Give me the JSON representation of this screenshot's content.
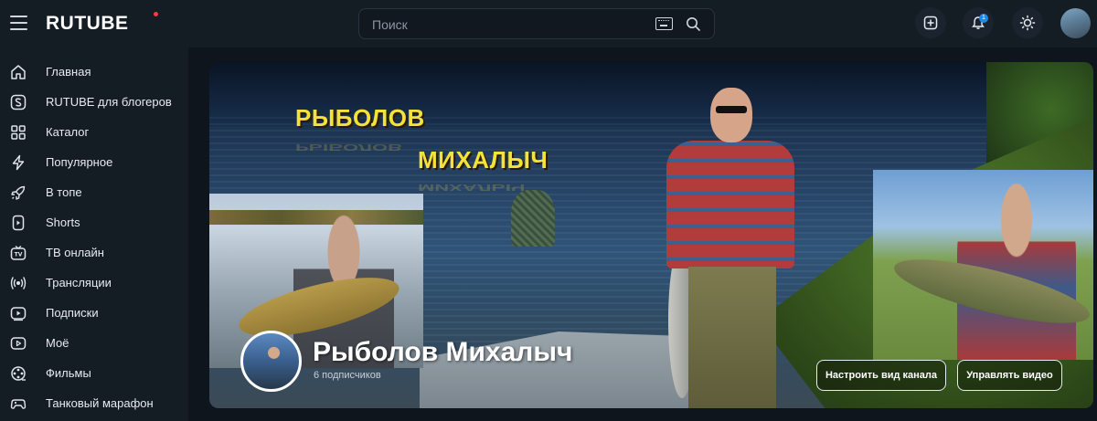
{
  "header": {
    "logo_text": "RUTUBE",
    "search": {
      "placeholder": "Поиск"
    },
    "notification_count": "1",
    "icons": [
      "menu-icon",
      "keyboard-icon",
      "search-icon",
      "upload-icon",
      "bell-icon",
      "sun-icon"
    ]
  },
  "sidebar": {
    "items": [
      {
        "label": "Главная",
        "icon": "home-icon"
      },
      {
        "label": "RUTUBE для блогеров",
        "icon": "studio-icon"
      },
      {
        "label": "Каталог",
        "icon": "grid-icon"
      },
      {
        "label": "Популярное",
        "icon": "lightning-icon"
      },
      {
        "label": "В топе",
        "icon": "rocket-icon"
      },
      {
        "label": "Shorts",
        "icon": "shorts-icon"
      },
      {
        "label": "ТВ онлайн",
        "icon": "tv-icon"
      },
      {
        "label": "Трансляции",
        "icon": "broadcast-icon"
      },
      {
        "label": "Подписки",
        "icon": "subscriptions-icon"
      },
      {
        "label": "Моё",
        "icon": "my-icon"
      },
      {
        "label": "Фильмы",
        "icon": "film-icon"
      },
      {
        "label": "Танковый марафон",
        "icon": "gamepad-icon"
      }
    ]
  },
  "banner": {
    "title_line1": "РЫБОЛОВ",
    "title_line2": "МИХАЛЫЧ"
  },
  "channel": {
    "name": "Рыболов Михалыч",
    "subscribers": "6 подписчиков",
    "customize_button": "Настроить вид канала",
    "manage_button": "Управлять видео"
  },
  "colors": {
    "background": "#0f151c",
    "panel": "#141c24",
    "logo_dot": "#ff3b3b",
    "badge": "#1e88e5",
    "banner_text": "#f3e23a"
  }
}
